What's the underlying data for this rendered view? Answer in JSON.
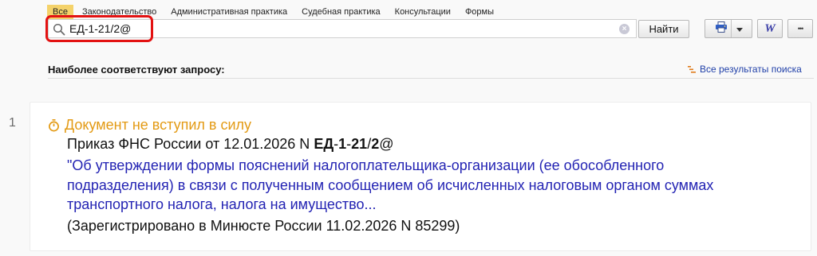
{
  "tabs": [
    {
      "label": "Все",
      "active": true
    },
    {
      "label": "Законодательство"
    },
    {
      "label": "Административная практика"
    },
    {
      "label": "Судебная практика"
    },
    {
      "label": "Консультации"
    },
    {
      "label": "Формы"
    }
  ],
  "search": {
    "value": "ЕД-1-21/2@",
    "placeholder": "",
    "find_label": "Найти"
  },
  "toolbar": {
    "print_icon": "printer-icon",
    "dropdown_icon": "chevron-down-icon",
    "word_label": "W",
    "more_label": "•••"
  },
  "results": {
    "section_title": "Наиболее соответствуют запросу:",
    "all_results_label": "Все результаты поиска",
    "items": [
      {
        "number": "1",
        "status": "Документ не вступил в силу",
        "title_prefix": "Приказ ФНС России от 12.01.2026 N ",
        "title_tokens": [
          {
            "text": "ЕД",
            "bold": true
          },
          {
            "text": "-",
            "bold": false
          },
          {
            "text": "1",
            "bold": true
          },
          {
            "text": "-",
            "bold": false
          },
          {
            "text": "21",
            "bold": true
          },
          {
            "text": "/",
            "bold": false
          },
          {
            "text": "2",
            "bold": true
          },
          {
            "text": "@",
            "bold": false
          }
        ],
        "link_text": "\"Об утверждении формы пояснений налогоплательщика-организации (ее обособленного подразделения) в связи с полученным сообщением об исчисленных налоговым органом суммах транспортного налога, налога на имущество...",
        "note": "(Зарегистрировано в Минюсте России 11.02.2026 N 85299)"
      }
    ]
  },
  "colors": {
    "active_tab": "#f4d26a",
    "status": "#e39a14",
    "link": "#2323b3",
    "highlight": "#e31212"
  }
}
